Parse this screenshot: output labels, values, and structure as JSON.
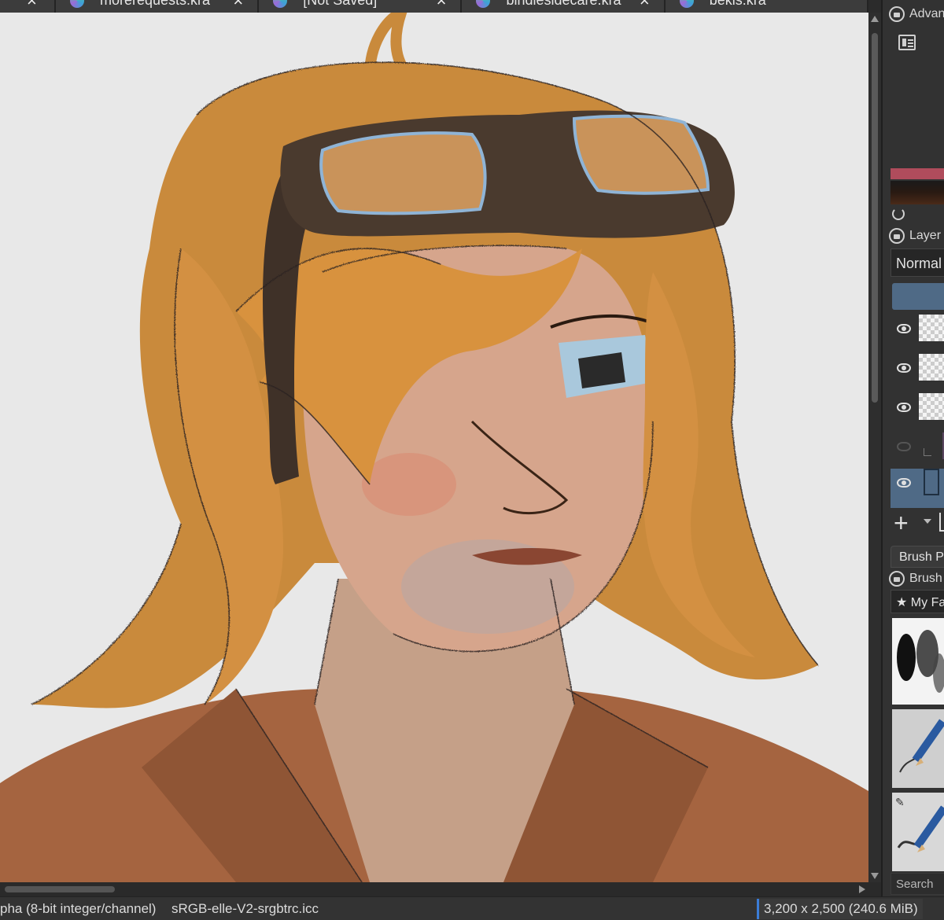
{
  "tabs": [
    {
      "label": ""
    },
    {
      "label": "morerequests.kra"
    },
    {
      "label": "[Not Saved]"
    },
    {
      "label": "bindlesidecare.kra"
    },
    {
      "label": "bekis.kra"
    }
  ],
  "icons": {
    "close": "×",
    "eye": "eye-icon",
    "lock": "lock-icon",
    "add": "+",
    "edit": "✎",
    "star": "★"
  },
  "dock": {
    "advanced_color_label": "Advan",
    "layers_label": "Layer",
    "blend_mode": "Normal",
    "brush_presets_tab": "Brush P",
    "brush_panel_label": "Brush",
    "favorites_tag": "My Fa",
    "search_placeholder": "Search"
  },
  "status": {
    "color_model": "pha (8-bit integer/channel)",
    "profile": "sRGB-elle-V2-srgbtrc.icc",
    "image_size": "3,200 x 2,500 (240.6 MiB)"
  },
  "colors": {
    "accent": "#3b7dd8",
    "selected_layer": "#4f6a86",
    "foreground_swatch": "#b04c5c",
    "canvas_bg": "#e8e8e8"
  }
}
